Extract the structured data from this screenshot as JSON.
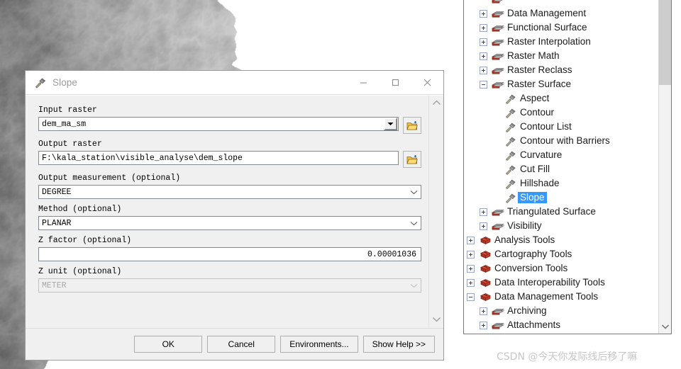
{
  "dialog": {
    "title": "Slope",
    "title_icon": "hammer-icon",
    "window_controls": {
      "minimize": "minimize-icon",
      "maximize": "maximize-icon",
      "close": "close-icon"
    },
    "fields": {
      "input_raster": {
        "label": "Input raster",
        "value": "dem_ma_sm",
        "browse_icon": "open-folder-icon"
      },
      "output_raster": {
        "label": "Output raster",
        "value": "F:\\kala_station\\visible_analyse\\dem_slope",
        "browse_icon": "open-folder-icon"
      },
      "output_measurement": {
        "label": "Output measurement (optional)",
        "value": "DEGREE"
      },
      "method": {
        "label": "Method (optional)",
        "value": "PLANAR"
      },
      "z_factor": {
        "label": "Z factor (optional)",
        "value": "0.00001036"
      },
      "z_unit": {
        "label": "Z unit (optional)",
        "value": "METER",
        "disabled": true
      }
    },
    "buttons": {
      "ok": "OK",
      "cancel": "Cancel",
      "environments": "Environments...",
      "show_help": "Show Help >>"
    },
    "scrollbar": {
      "up": "chevron-up-icon",
      "down": "chevron-down-icon"
    }
  },
  "toolbox": {
    "scroll_down_icon": "chevron-down-icon",
    "rows": [
      {
        "label": "",
        "indent": 1,
        "toggle": "none",
        "icon": "toolset-icon",
        "clipped": true
      },
      {
        "label": "Data Management",
        "indent": 1,
        "toggle": "plus",
        "icon": "toolset-icon"
      },
      {
        "label": "Functional Surface",
        "indent": 1,
        "toggle": "plus",
        "icon": "toolset-icon"
      },
      {
        "label": "Raster Interpolation",
        "indent": 1,
        "toggle": "plus",
        "icon": "toolset-icon"
      },
      {
        "label": "Raster Math",
        "indent": 1,
        "toggle": "plus",
        "icon": "toolset-icon"
      },
      {
        "label": "Raster Reclass",
        "indent": 1,
        "toggle": "plus",
        "icon": "toolset-icon"
      },
      {
        "label": "Raster Surface",
        "indent": 1,
        "toggle": "minus",
        "icon": "toolset-icon"
      },
      {
        "label": "Aspect",
        "indent": 2,
        "toggle": "none",
        "icon": "tool-icon"
      },
      {
        "label": "Contour",
        "indent": 2,
        "toggle": "none",
        "icon": "tool-icon"
      },
      {
        "label": "Contour List",
        "indent": 2,
        "toggle": "none",
        "icon": "tool-icon"
      },
      {
        "label": "Contour with Barriers",
        "indent": 2,
        "toggle": "none",
        "icon": "tool-icon"
      },
      {
        "label": "Curvature",
        "indent": 2,
        "toggle": "none",
        "icon": "tool-icon"
      },
      {
        "label": "Cut Fill",
        "indent": 2,
        "toggle": "none",
        "icon": "tool-icon"
      },
      {
        "label": "Hillshade",
        "indent": 2,
        "toggle": "none",
        "icon": "tool-icon"
      },
      {
        "label": "Slope",
        "indent": 2,
        "toggle": "none",
        "icon": "tool-icon",
        "selected": true
      },
      {
        "label": "Triangulated Surface",
        "indent": 1,
        "toggle": "plus",
        "icon": "toolset-icon"
      },
      {
        "label": "Visibility",
        "indent": 1,
        "toggle": "plus",
        "icon": "toolset-icon"
      },
      {
        "label": "Analysis Tools",
        "indent": 0,
        "toggle": "plus",
        "icon": "toolbox-icon"
      },
      {
        "label": "Cartography Tools",
        "indent": 0,
        "toggle": "plus",
        "icon": "toolbox-icon"
      },
      {
        "label": "Conversion Tools",
        "indent": 0,
        "toggle": "plus",
        "icon": "toolbox-icon"
      },
      {
        "label": "Data Interoperability Tools",
        "indent": 0,
        "toggle": "plus",
        "icon": "toolbox-icon"
      },
      {
        "label": "Data Management Tools",
        "indent": 0,
        "toggle": "minus",
        "icon": "toolbox-icon"
      },
      {
        "label": "Archiving",
        "indent": 1,
        "toggle": "plus",
        "icon": "toolset-icon"
      },
      {
        "label": "Attachments",
        "indent": 1,
        "toggle": "plus",
        "icon": "toolset-icon"
      },
      {
        "label": "",
        "indent": 1,
        "toggle": "none",
        "icon": "toolset-icon",
        "clipped": true
      }
    ]
  },
  "watermark": "CSDN @今天你发际线后移了嘛",
  "colors": {
    "selection_blue": "#3399ff",
    "toolbox_red": "#c0392b",
    "dialog_bg": "#f0f0f0",
    "panel_border": "#7a7a7a"
  }
}
